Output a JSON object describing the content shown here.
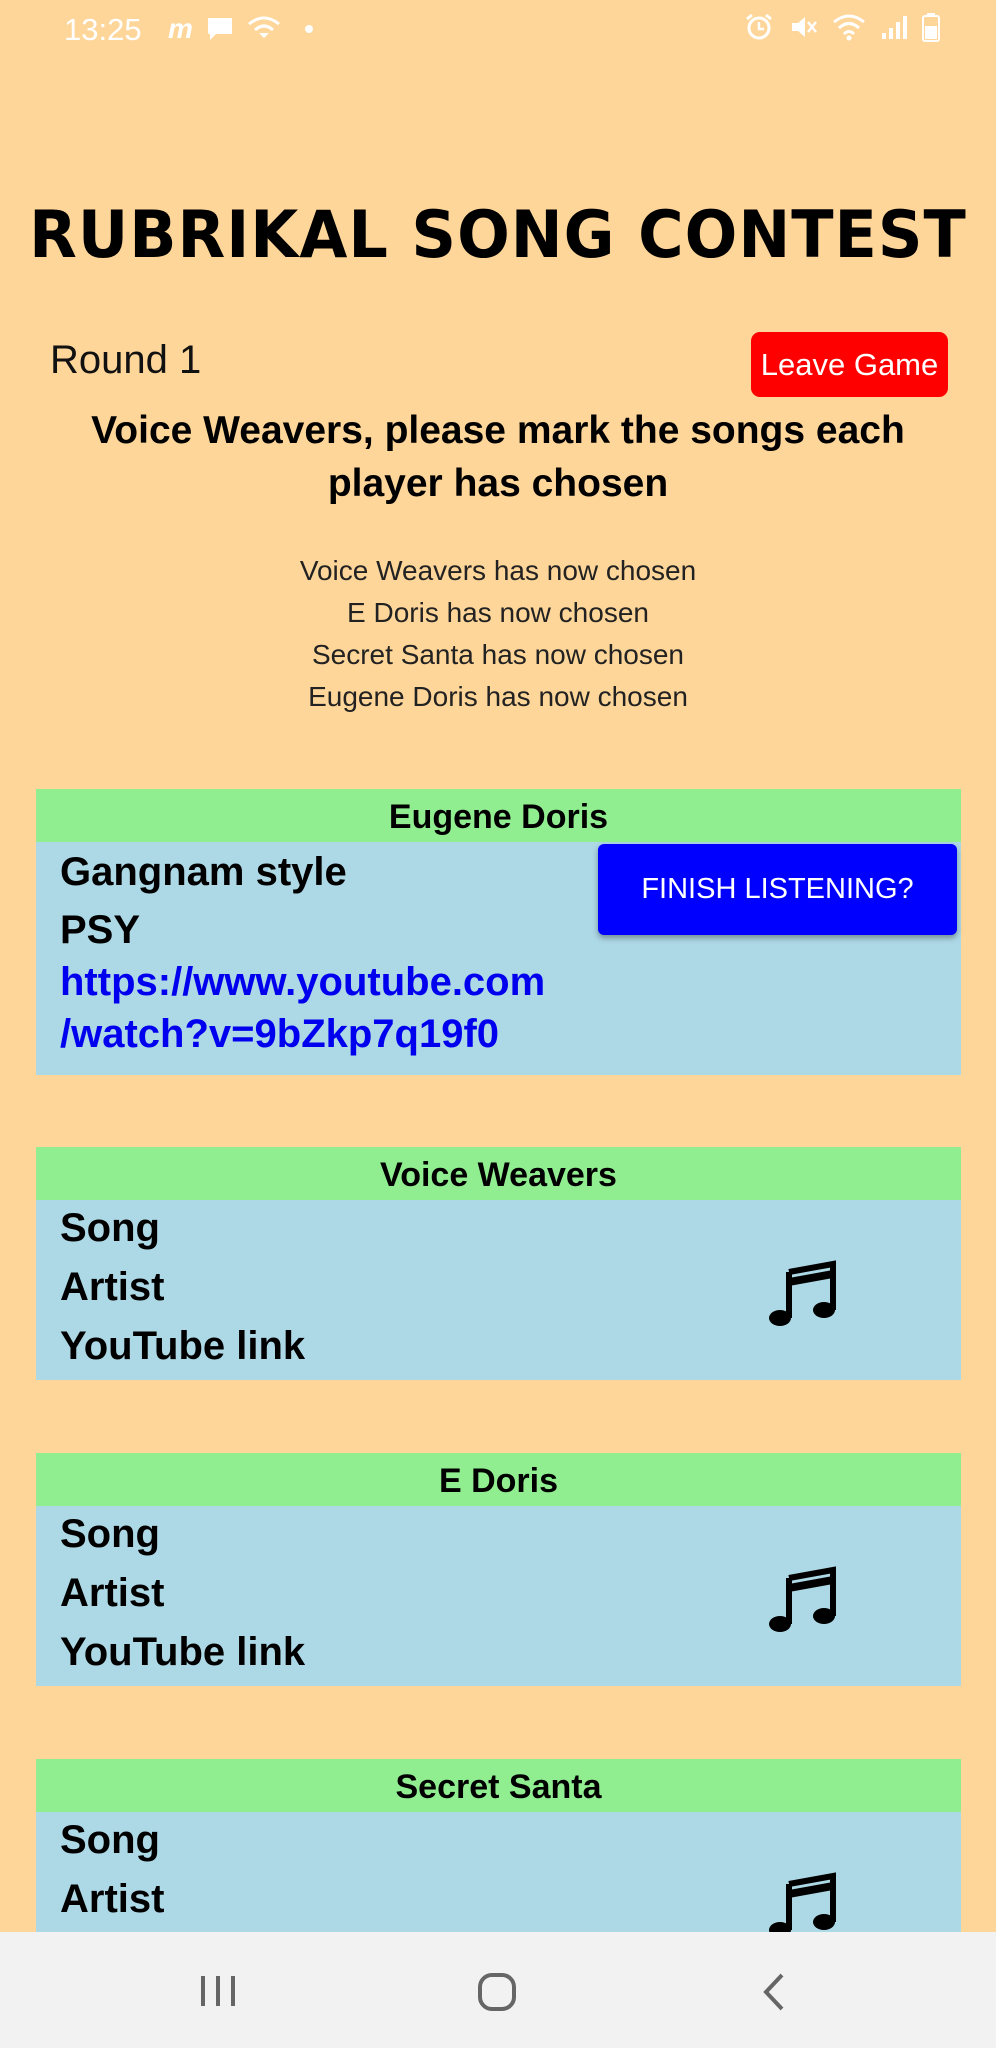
{
  "status_bar": {
    "time": "13:25",
    "left_icons": [
      "messenger-icon",
      "chat-icon",
      "wifi-calling-icon"
    ],
    "right_icons": [
      "alarm-icon",
      "mute-icon",
      "wifi-icon",
      "signal-icon",
      "battery-icon"
    ]
  },
  "header": {
    "title": "RUBRIKAL SONG CONTEST",
    "round": "Round 1",
    "leave_label": "Leave Game"
  },
  "instruction": "Voice Weavers, please mark the songs each player has chosen",
  "status_lines": [
    "Voice Weavers has now chosen",
    "E Doris has now chosen",
    "Secret Santa has now chosen",
    "Eugene Doris has now chosen"
  ],
  "players": [
    {
      "name": "Eugene Doris",
      "song": "Gangnam style",
      "artist": "PSY",
      "link_line1": "https://www.youtube.com",
      "link_line2": "/watch?v=9bZkp7q19f0",
      "action_label": "FINISH LISTENING?"
    },
    {
      "name": "Voice Weavers",
      "song": "Song",
      "artist": "Artist",
      "link": "YouTube link",
      "icon": "music-note-icon"
    },
    {
      "name": "E Doris",
      "song": "Song",
      "artist": "Artist",
      "link": "YouTube link",
      "icon": "music-note-icon"
    },
    {
      "name": "Secret Santa",
      "song": "Song",
      "artist": "Artist",
      "icon": "music-note-icon"
    }
  ],
  "colors": {
    "background": "#fed699",
    "card_header": "#90ee90",
    "card_body": "#add8e6",
    "leave_button": "#fe0000",
    "finish_button": "#0000fe",
    "link": "#0000ee"
  }
}
